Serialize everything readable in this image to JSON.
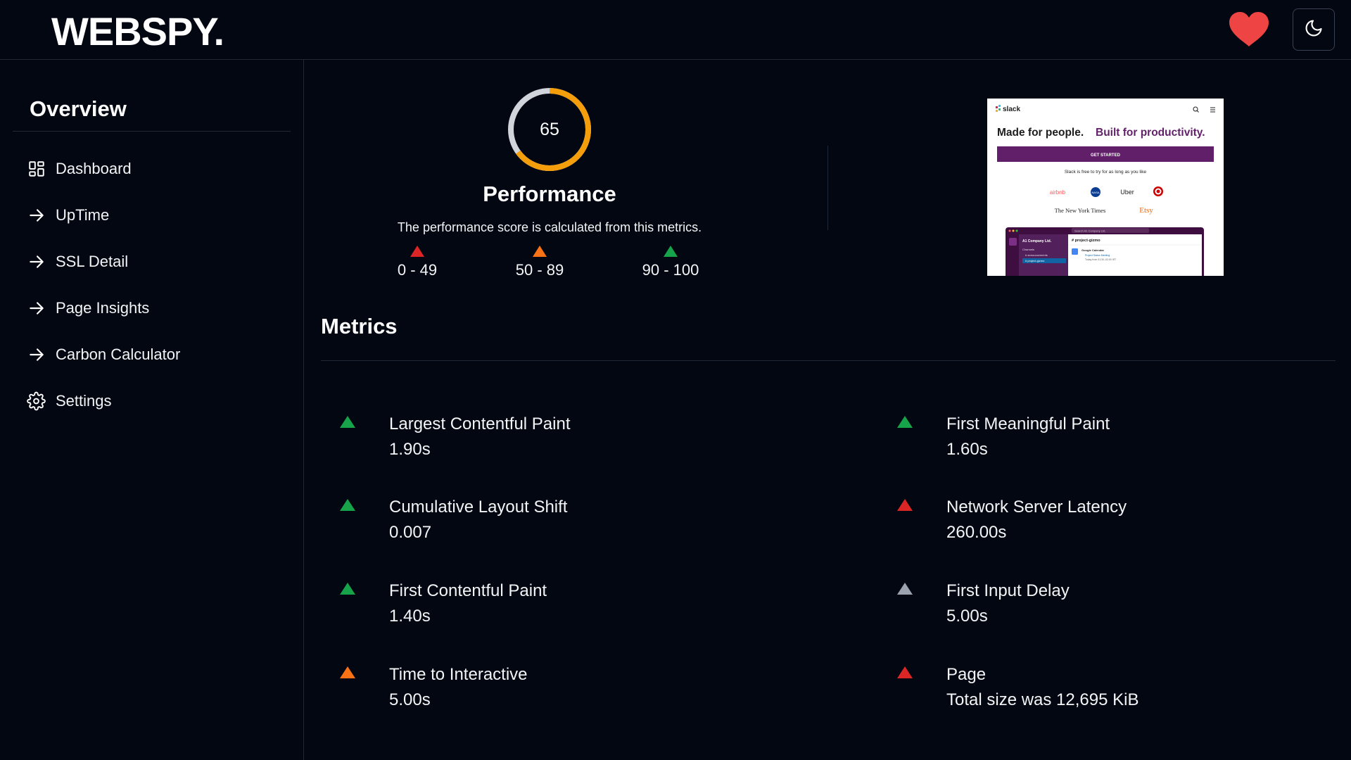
{
  "header": {
    "logo": "WEBSPY.",
    "favorite_icon": "heart-icon",
    "theme_icon": "moon-icon"
  },
  "sidebar": {
    "title": "Overview",
    "items": [
      {
        "label": "Dashboard",
        "icon": "grid-icon"
      },
      {
        "label": "UpTime",
        "icon": "arrow-right-icon"
      },
      {
        "label": "SSL Detail",
        "icon": "arrow-right-icon"
      },
      {
        "label": "Page Insights",
        "icon": "arrow-right-icon"
      },
      {
        "label": "Carbon Calculator",
        "icon": "arrow-right-icon"
      },
      {
        "label": "Settings",
        "icon": "gear-icon"
      }
    ]
  },
  "performance": {
    "score": "65",
    "score_fraction": 0.65,
    "title": "Performance",
    "description": "The performance score is calculated from this metrics.",
    "legend": [
      {
        "range": "0 - 49",
        "color": "#dc2626"
      },
      {
        "range": "50 - 89",
        "color": "#f97316"
      },
      {
        "range": "90 - 100",
        "color": "#16a34a"
      }
    ],
    "gauge_color": "#f59e0b",
    "gauge_track_color": "#d1d5db"
  },
  "preview": {
    "brand": "slack",
    "headline_a": "Made for people.",
    "headline_b": "Built for productivity.",
    "cta": "GET STARTED",
    "subtext": "Slack is free to try for as long as you like",
    "logos": [
      "airbnb",
      "NASA",
      "Uber",
      "target",
      "The New York Times",
      "Etsy"
    ],
    "app_workspace": "A1 Company Ltd.",
    "app_channel": "# project-gizmo",
    "app_channels_label": "Channels",
    "app_channel_1": "# announcements",
    "app_channel_2": "# project-gizmo",
    "app_event_title": "Google Calendar",
    "app_event_name": "Project Status Meeting",
    "app_event_time": "Today from 01:30–02:00 IST",
    "app_search": "Search A1 Company Ltd."
  },
  "metrics": {
    "title": "Metrics",
    "items": [
      {
        "name": "Largest Contentful Paint",
        "value": "1.90s",
        "status_color": "#16a34a"
      },
      {
        "name": "First Meaningful Paint",
        "value": "1.60s",
        "status_color": "#16a34a"
      },
      {
        "name": "Cumulative Layout Shift",
        "value": "0.007",
        "status_color": "#16a34a"
      },
      {
        "name": "Network Server Latency",
        "value": "260.00s",
        "status_color": "#dc2626"
      },
      {
        "name": "First Contentful Paint",
        "value": "1.40s",
        "status_color": "#16a34a"
      },
      {
        "name": "First Input Delay",
        "value": "5.00s",
        "status_color": "#9ca3af"
      },
      {
        "name": "Time to Interactive",
        "value": "5.00s",
        "status_color": "#f97316"
      },
      {
        "name": "Page",
        "value": "Total size was 12,695 KiB",
        "status_color": "#dc2626"
      }
    ]
  }
}
